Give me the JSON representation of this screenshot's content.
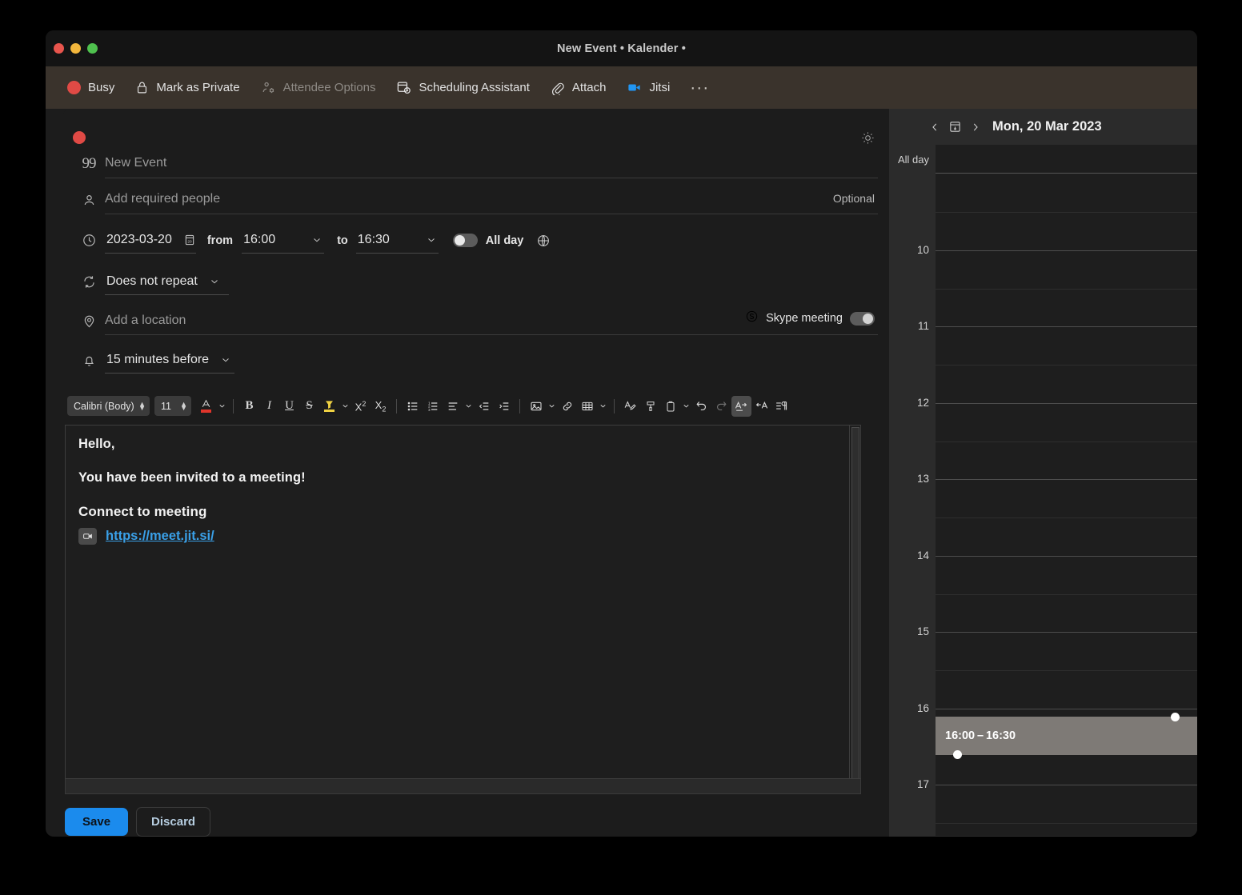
{
  "window": {
    "title": "New Event • Kalender •",
    "traffic_lights": [
      "close",
      "minimize",
      "maximize"
    ]
  },
  "ribbon": {
    "items": [
      {
        "label": "Busy",
        "icon": "busy-dot-icon",
        "dim": false
      },
      {
        "label": "Mark as Private",
        "icon": "lock-icon",
        "dim": false
      },
      {
        "label": "Attendee Options",
        "icon": "attendee-options-icon",
        "dim": true
      },
      {
        "label": "Scheduling Assistant",
        "icon": "scheduling-assistant-icon",
        "dim": false
      },
      {
        "label": "Attach",
        "icon": "paperclip-icon",
        "dim": false
      },
      {
        "label": "Jitsi",
        "icon": "video-camera-icon",
        "dim": false
      }
    ],
    "more_label": "···"
  },
  "form": {
    "category_color": "#e04a45",
    "brightness_icon": "sun-icon",
    "title": {
      "value": "",
      "placeholder": "New Event",
      "icon": "quote-icon",
      "icon_glyph": "99"
    },
    "attendees": {
      "value": "",
      "placeholder": "Add required people",
      "icon": "person-icon",
      "optional_label": "Optional"
    },
    "datetime": {
      "icon": "clock-icon",
      "date": "2023-03-20",
      "calendar_icon": "calendar-picker-icon",
      "from_label": "from",
      "start_time": "16:00",
      "to_label": "to",
      "end_time": "16:30",
      "all_day_label": "All day",
      "all_day_on": false,
      "timezone_icon": "globe-icon"
    },
    "repeat": {
      "icon": "repeat-icon",
      "value": "Does not repeat"
    },
    "location": {
      "icon": "location-pin-icon",
      "value": "",
      "placeholder": "Add a location"
    },
    "skype": {
      "icon": "skype-icon",
      "label": "Skype meeting",
      "on": false
    },
    "reminder": {
      "icon": "bell-icon",
      "value": "15 minutes before"
    }
  },
  "rich_text_toolbar": {
    "font_family": "Calibri (Body)",
    "font_size": "11",
    "font_color": "#e0352b",
    "highlight_color": "#f0d243",
    "buttons": [
      {
        "name": "font-color-button",
        "label": "A"
      },
      {
        "name": "bold-button",
        "label": "B"
      },
      {
        "name": "italic-button",
        "label": "I"
      },
      {
        "name": "underline-button",
        "label": "U"
      },
      {
        "name": "strikethrough-button",
        "label": "S"
      },
      {
        "name": "highlight-button",
        "label": ""
      },
      {
        "name": "superscript-button",
        "label": "X²"
      },
      {
        "name": "subscript-button",
        "label": "X₂"
      },
      {
        "name": "bullet-list-button",
        "label": ""
      },
      {
        "name": "numbered-list-button",
        "label": ""
      },
      {
        "name": "align-button",
        "label": ""
      },
      {
        "name": "decrease-indent-button",
        "label": ""
      },
      {
        "name": "increase-indent-button",
        "label": ""
      },
      {
        "name": "insert-image-button",
        "label": ""
      },
      {
        "name": "insert-link-button",
        "label": ""
      },
      {
        "name": "insert-table-button",
        "label": ""
      },
      {
        "name": "spellcheck-button",
        "label": ""
      },
      {
        "name": "format-painter-button",
        "label": ""
      },
      {
        "name": "paste-options-button",
        "label": ""
      },
      {
        "name": "undo-button",
        "label": ""
      },
      {
        "name": "redo-button",
        "label": ""
      },
      {
        "name": "text-direction-ltr-button",
        "label": ""
      },
      {
        "name": "text-direction-rtl-button",
        "label": ""
      },
      {
        "name": "paragraph-marks-button",
        "label": ""
      }
    ]
  },
  "body": {
    "greeting": "Hello,",
    "invite_text": "You have been invited to a meeting!",
    "connect_heading": "Connect to meeting",
    "meeting_link": "https://meet.jit.si/",
    "link_color": "#3aa0e8",
    "link_icon": "video-chip-icon"
  },
  "footer": {
    "save_label": "Save",
    "discard_label": "Discard",
    "save_color": "#1b8bed"
  },
  "calendar": {
    "prev_icon": "chevron-left-icon",
    "today_icon": "today-calendar-icon",
    "next_icon": "chevron-right-icon",
    "date_label": "Mon, 20 Mar 2023",
    "all_day_label": "All day",
    "hours": [
      "",
      "10",
      "11",
      "12",
      "13",
      "14",
      "15",
      "16",
      "17"
    ],
    "event": {
      "time_range": "16:00 – 16:30",
      "background": "#7e7a76",
      "top_handle": "resize-handle-top",
      "bottom_handle": "resize-handle-bottom"
    }
  }
}
